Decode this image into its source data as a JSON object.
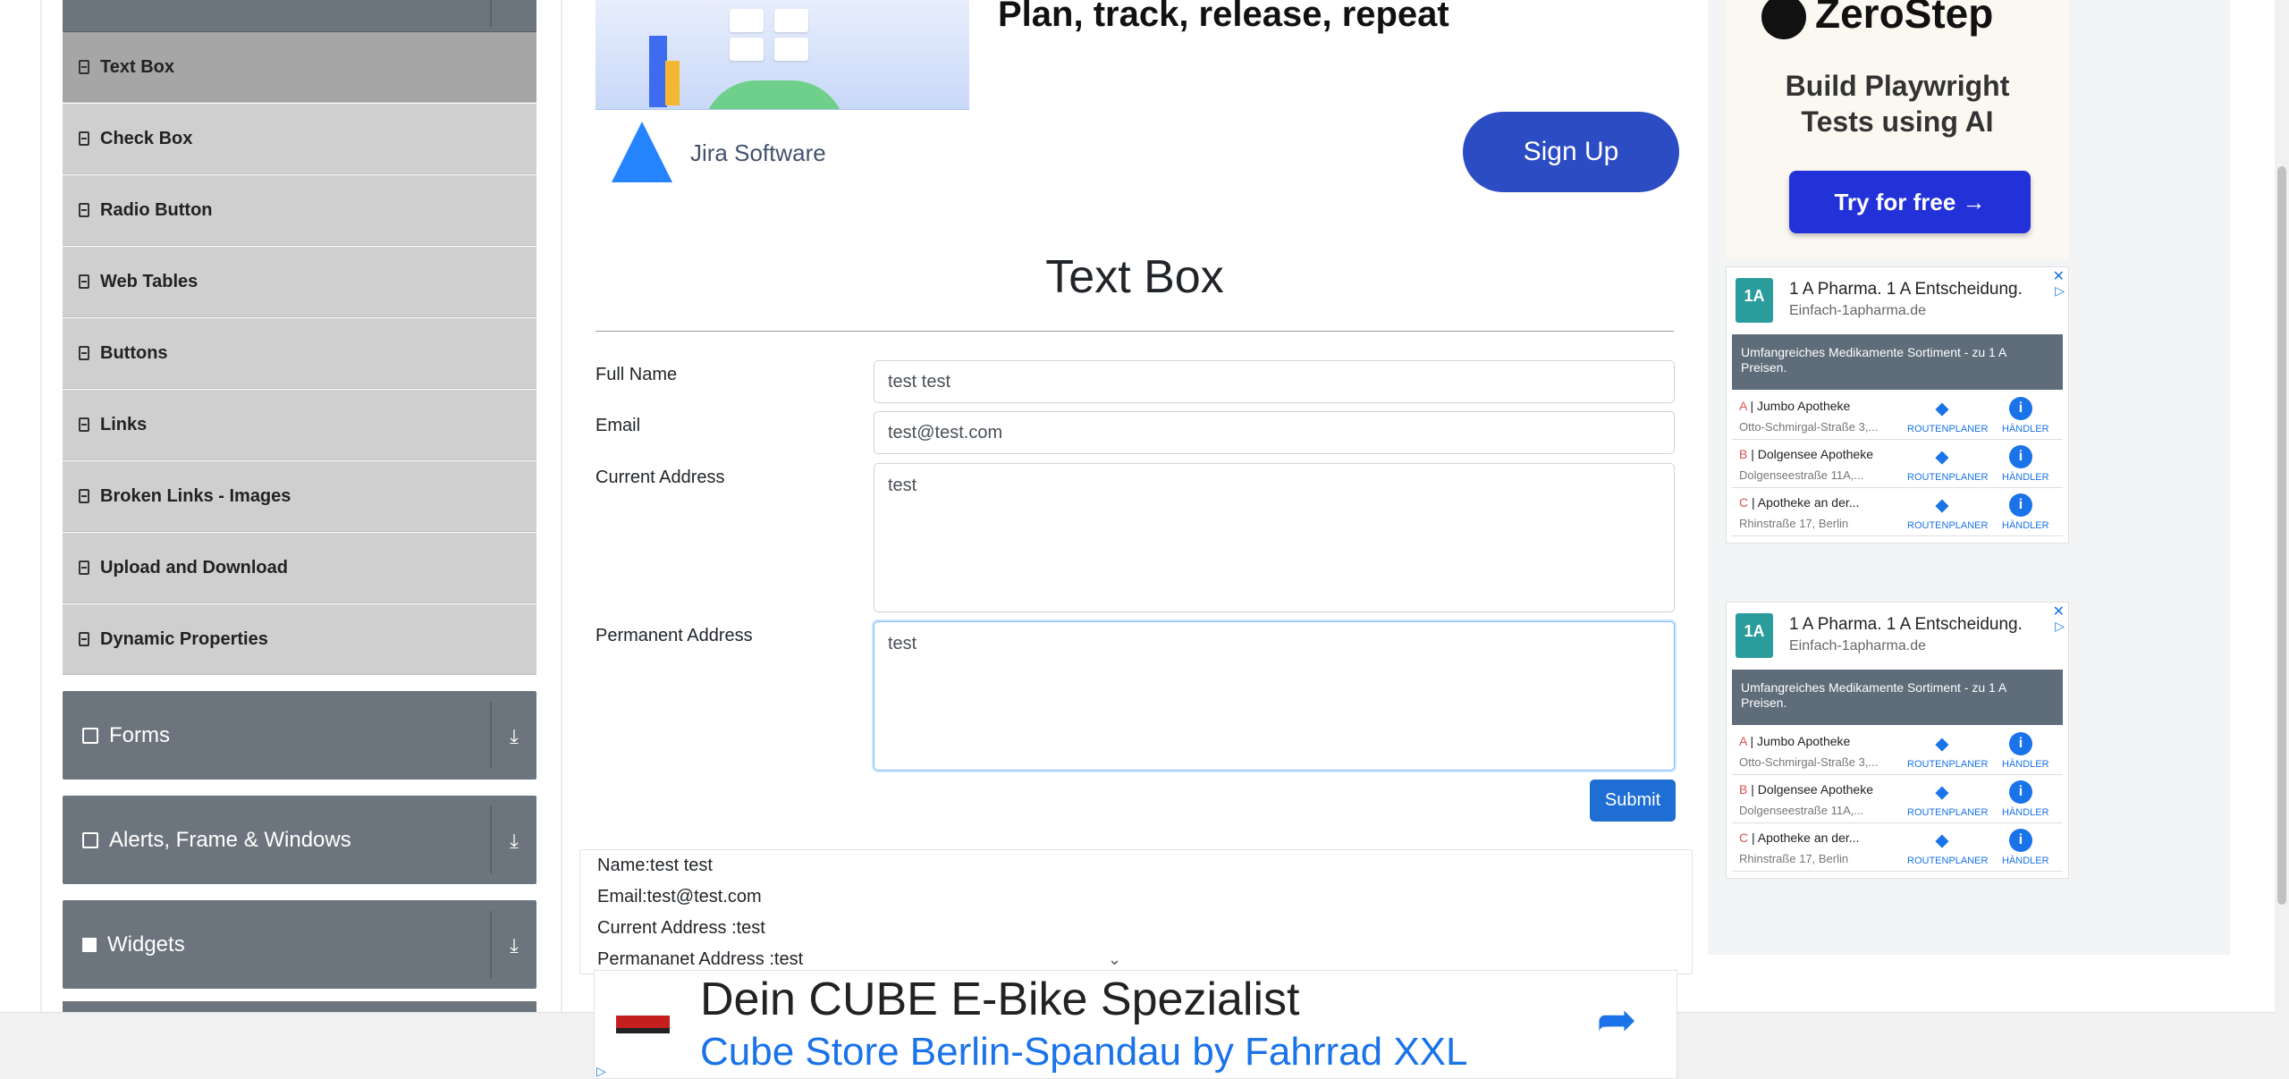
{
  "sidebar": {
    "items": [
      {
        "label": "Text Box",
        "active": true
      },
      {
        "label": "Check Box"
      },
      {
        "label": "Radio Button"
      },
      {
        "label": "Web Tables"
      },
      {
        "label": "Buttons"
      },
      {
        "label": "Links"
      },
      {
        "label": "Broken Links - Images"
      },
      {
        "label": "Upload and Download"
      },
      {
        "label": "Dynamic Properties"
      }
    ],
    "groups": [
      {
        "label": "Forms",
        "icon": "form-icon"
      },
      {
        "label": "Alerts, Frame & Windows",
        "icon": "window-icon"
      },
      {
        "label": "Widgets",
        "icon": "widgets-icon"
      }
    ]
  },
  "top_ad": {
    "headline": "Plan, track, release, repeat",
    "brand": "Jira Software",
    "cta": "Sign Up"
  },
  "form": {
    "title": "Text Box",
    "full_name_label": "Full Name",
    "full_name_value": "test test",
    "email_label": "Email",
    "email_value": "test@test.com",
    "current_address_label": "Current Address",
    "current_address_value": "test",
    "permanent_address_label": "Permanent Address",
    "permanent_address_value": "test",
    "submit_label": "Submit"
  },
  "output": {
    "name": "Name:test test",
    "email": "Email:test@test.com",
    "current_address": "Current Address :test",
    "permanent_address": "Permananet Address :test"
  },
  "right_ads": {
    "zerostep": {
      "logo": "ZeroStep",
      "tagline_line1": "Build Playwright",
      "tagline_line2": "Tests using AI",
      "cta": "Try for free →"
    },
    "pharma": {
      "logo": "1A",
      "title": "1 A Pharma. 1 A Entscheidung.",
      "url": "Einfach-1apharma.de",
      "banner": "Umfangreiches Medikamente Sortiment - zu 1 A Preisen.",
      "route_label": "ROUTENPLANER",
      "dealer_label": "HÄNDLER",
      "stores": [
        {
          "letter": "A",
          "name": "Jumbo Apotheke",
          "address": "Otto-Schmirgal-Straße 3,..."
        },
        {
          "letter": "B",
          "name": "Dolgensee Apotheke",
          "address": "Dolgenseestraße 11A,..."
        },
        {
          "letter": "C",
          "name": "Apotheke an der...",
          "address": "Rhinstraße 17, Berlin"
        }
      ]
    }
  },
  "bottom_ad": {
    "line1": "Dein CUBE E-Bike Spezialist",
    "line2": "Cube Store Berlin-Spandau by Fahrrad XXL"
  },
  "colors": {
    "sidebar_group": "#6c757d",
    "sidebar_item": "#cfcfcf",
    "submit": "#1f6ed4",
    "signup": "#2c4cc4",
    "try_free": "#2331d8"
  }
}
